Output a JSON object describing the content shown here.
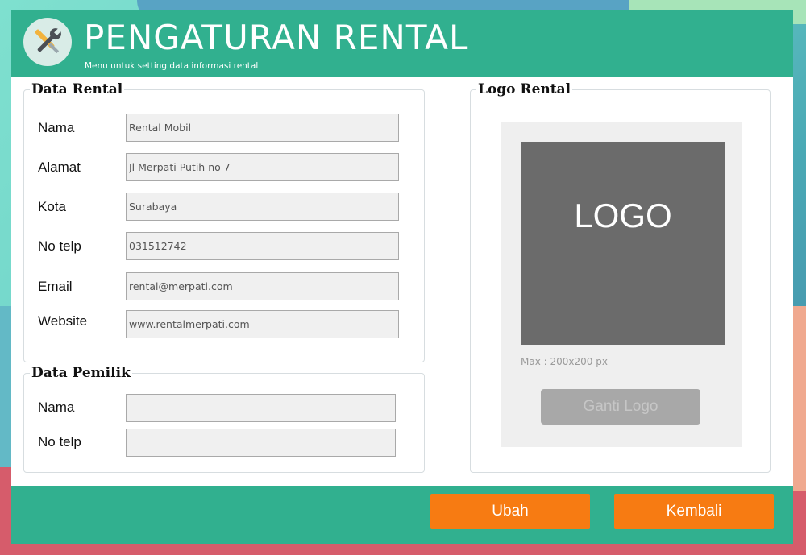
{
  "header": {
    "title": "PENGATURAN RENTAL",
    "subtitle": "Menu untuk setting data informasi rental",
    "icon": "tools-icon"
  },
  "data_rental": {
    "title": "Data Rental",
    "fields": [
      {
        "label": "Nama",
        "value": "Rental Mobil"
      },
      {
        "label": "Alamat",
        "value": "Jl Merpati Putih no 7"
      },
      {
        "label": "Kota",
        "value": "Surabaya"
      },
      {
        "label": "No telp",
        "value": "031512742"
      },
      {
        "label": "Email",
        "value": "rental@merpati.com"
      },
      {
        "label": "Website",
        "value": "www.rentalmerpati.com"
      }
    ]
  },
  "data_pemilik": {
    "title": "Data Pemilik",
    "fields": [
      {
        "label": "Nama",
        "value": ""
      },
      {
        "label": "No telp",
        "value": ""
      }
    ]
  },
  "logo_rental": {
    "title": "Logo Rental",
    "placeholder_text": "LOGO",
    "hint": "Max : 200x200 px",
    "change_button": "Ganti  Logo"
  },
  "footer": {
    "save_button": "Ubah",
    "back_button": "Kembali"
  },
  "colors": {
    "header": "#31b08f",
    "button": "#f77b12",
    "logo_box": "#6b6b6b",
    "disabled_button": "#a8a8a8"
  }
}
